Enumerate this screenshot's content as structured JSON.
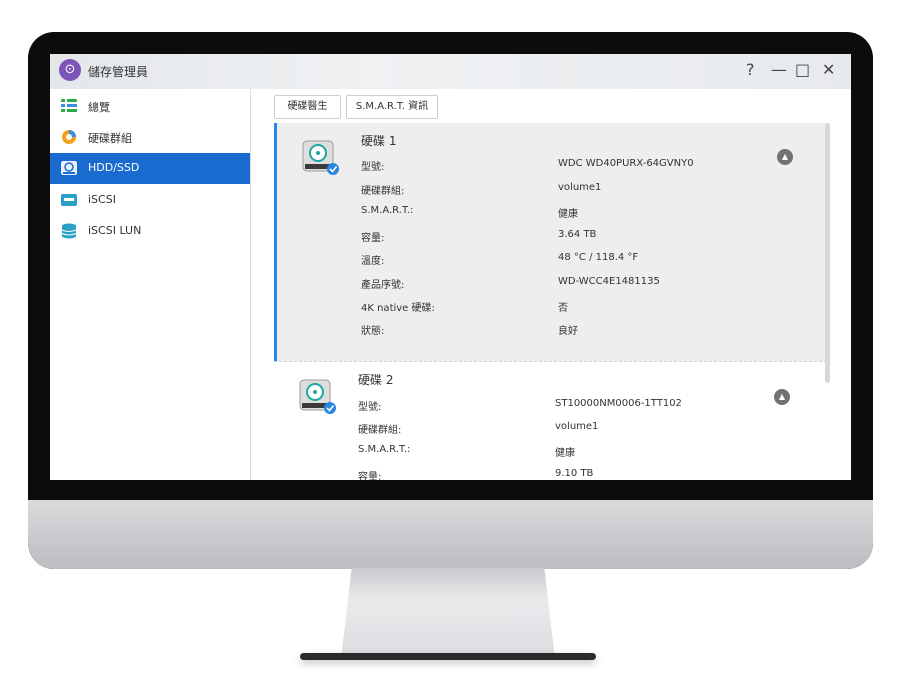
{
  "app": {
    "title": "儲存管理員",
    "window_controls": {
      "help": "?",
      "minimize": "—",
      "maximize": "□",
      "close": "✕"
    }
  },
  "sidebar": {
    "items": [
      {
        "label": "總覽",
        "icon": "overview-icon",
        "active": false
      },
      {
        "label": "硬碟群組",
        "icon": "disk-group-icon",
        "active": false
      },
      {
        "label": "HDD/SSD",
        "icon": "hdd-icon",
        "active": true
      },
      {
        "label": "iSCSI",
        "icon": "iscsi-icon",
        "active": false
      },
      {
        "label": "iSCSI LUN",
        "icon": "iscsi-lun-icon",
        "active": false
      }
    ]
  },
  "toolbar": {
    "doctor_label": "硬碟醫生",
    "smart_label": "S.M.A.R.T. 資訊"
  },
  "disks": [
    {
      "title": "硬碟 1",
      "props": [
        {
          "label": "型號:",
          "value": "WDC WD40PURX-64GVNY0"
        },
        {
          "label": "硬碟群組:",
          "value": "volume1"
        },
        {
          "label": "S.M.A.R.T.:",
          "value": "健康"
        },
        {
          "label": "容量:",
          "value": "3.64 TB"
        },
        {
          "label": "溫度:",
          "value": "48 °C / 118.4 °F"
        },
        {
          "label": "產品序號:",
          "value": "WD-WCC4E1481135"
        },
        {
          "label": "4K native 硬碟:",
          "value": "否"
        },
        {
          "label": "狀態:",
          "value": "良好"
        }
      ]
    },
    {
      "title": "硬碟 2",
      "props": [
        {
          "label": "型號:",
          "value": "ST10000NM0006-1TT102"
        },
        {
          "label": "硬碟群組:",
          "value": "volume1"
        },
        {
          "label": "S.M.A.R.T.:",
          "value": "健康"
        },
        {
          "label": "容量:",
          "value": "9.10 TB"
        }
      ]
    }
  ],
  "colors": {
    "accent": "#1a6bcf",
    "selected_border": "#2a86e3",
    "app_icon": "#7b56b8"
  }
}
